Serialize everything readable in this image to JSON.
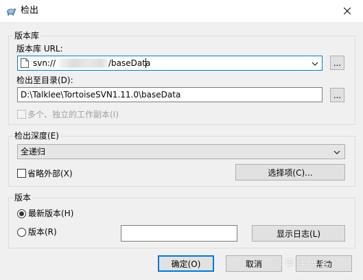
{
  "window": {
    "title": "检出",
    "icon": "tortoise-svn-icon",
    "close_icon": "close-icon"
  },
  "repository": {
    "group_label": "版本库",
    "url_label": "版本库 URL:",
    "url_prefix": "svn://",
    "url_suffix": "/baseData",
    "checkout_dir_label": "检出至目录(D):",
    "checkout_dir_value": "D:\\Talklee\\TortoiseSVN1.11.0\\baseData",
    "browse_label": "...",
    "multiple_label": "多个、独立的工作副本(I)"
  },
  "depth": {
    "group_label": "检出深度(E)",
    "selected": "全递归",
    "omit_externals_label": "省略外部(X)",
    "choose_items_label": "选择项(C)..."
  },
  "revision": {
    "group_label": "版本",
    "head_label": "最新版本(H)",
    "specific_label": "版本(R)",
    "revision_value": "",
    "show_log_label": "显示日志(L)"
  },
  "footer": {
    "ok_label": "确定(O)",
    "cancel_label": "取消",
    "help_label": "帮助",
    "watermark": "@李洋博客"
  }
}
